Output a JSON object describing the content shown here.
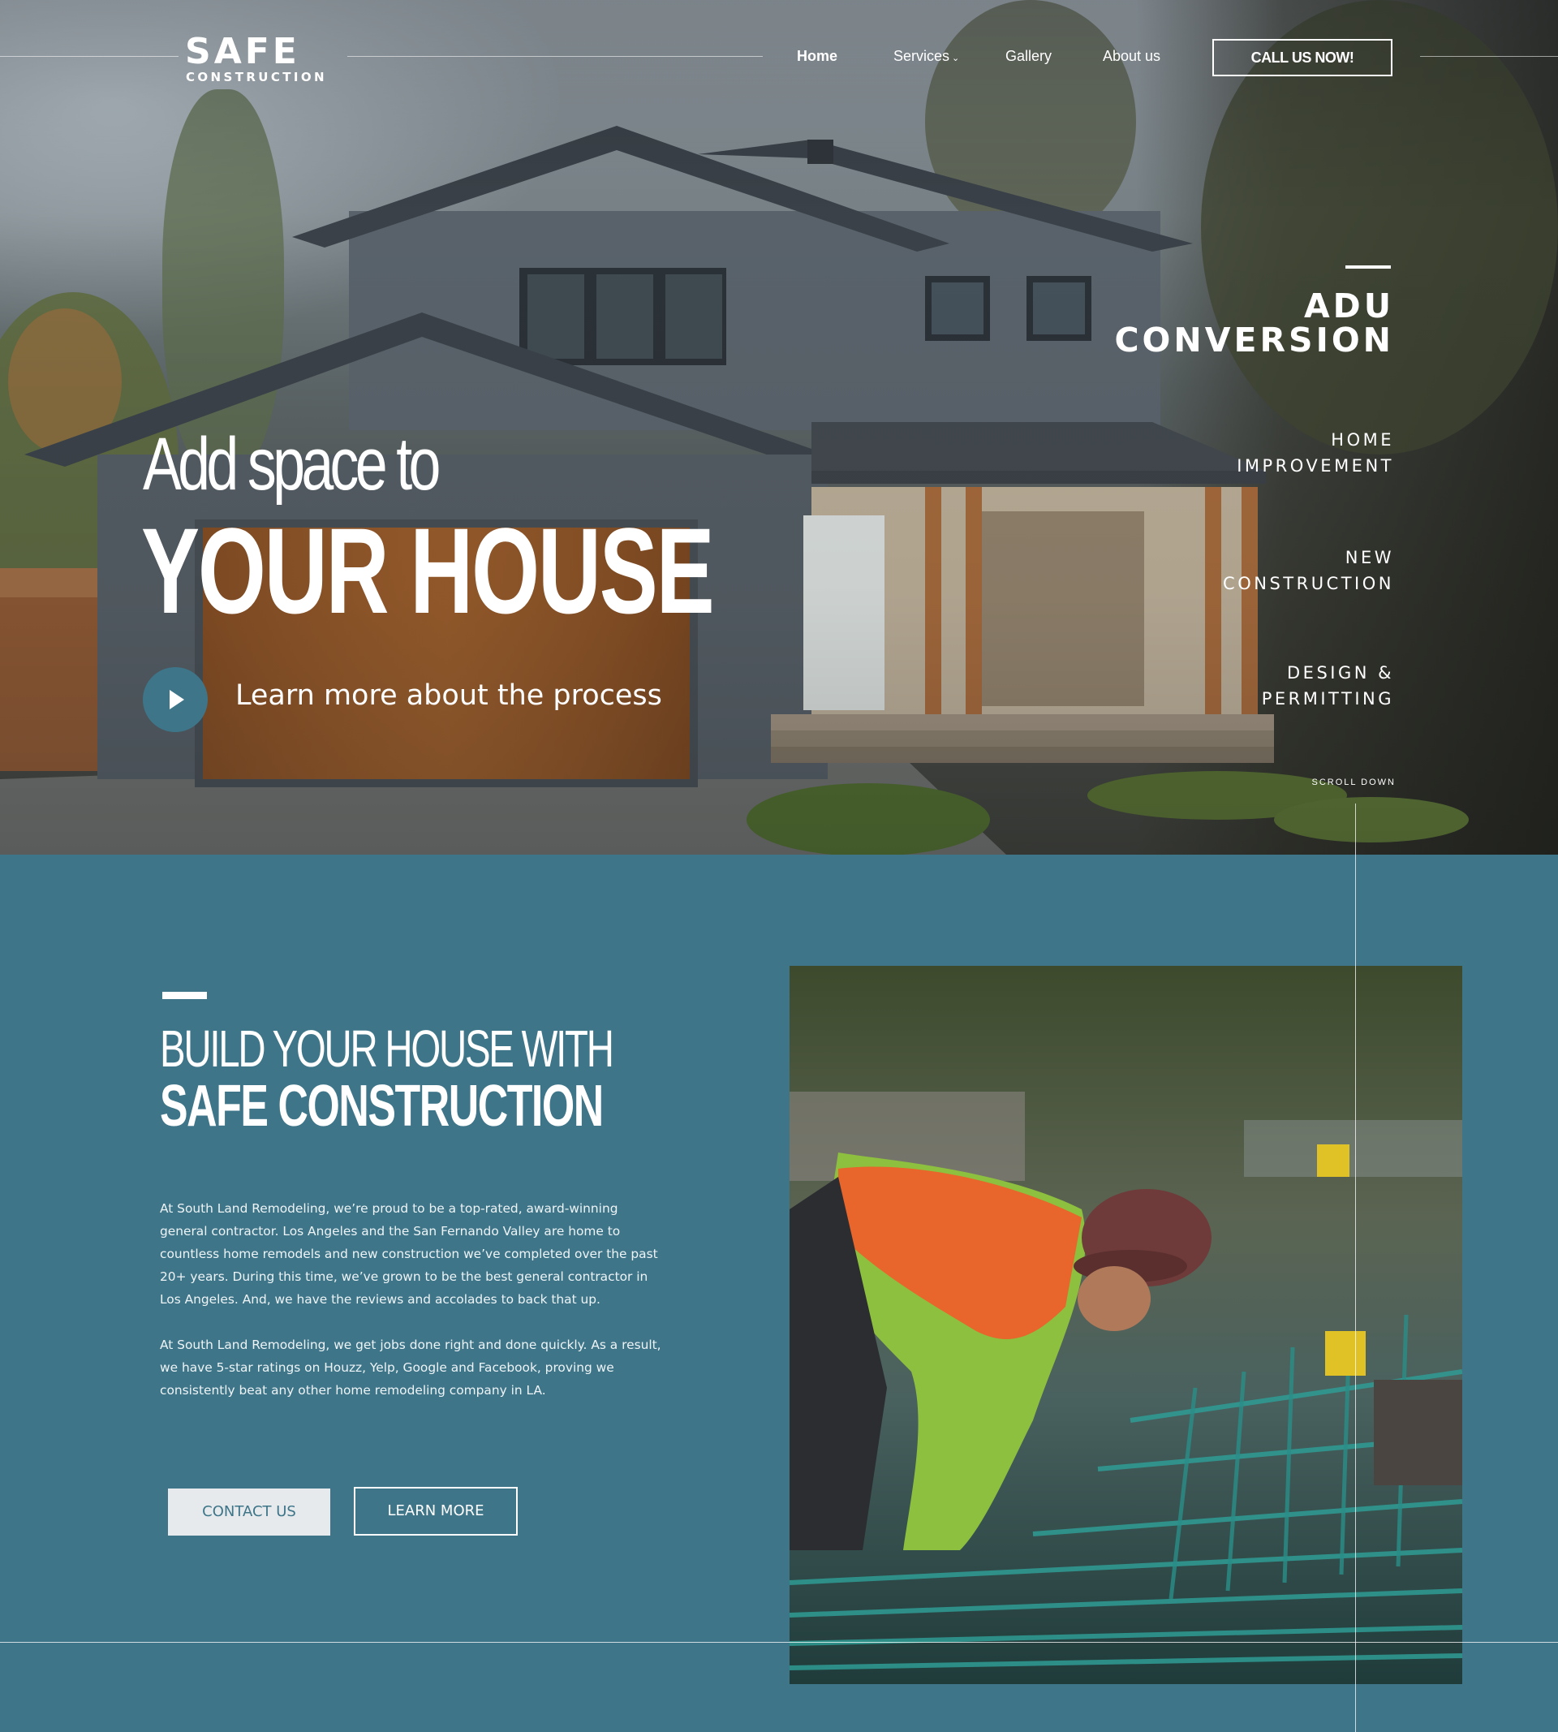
{
  "brand": {
    "logo_main": "SAFE",
    "logo_sub": "CONSTRUCTION"
  },
  "nav": {
    "items": [
      {
        "label": "Home",
        "active": true
      },
      {
        "label": "Services",
        "has_dropdown": true
      },
      {
        "label": "Gallery"
      },
      {
        "label": "About us"
      }
    ],
    "cta_label": "CALL US NOW!"
  },
  "hero": {
    "headline_line1": "Add space to",
    "headline_line2": "YOUR HOUSE",
    "video_link_label": "Learn more about the process",
    "services": [
      {
        "line1": "ADU",
        "line2": "CONVERSION",
        "featured": true
      },
      {
        "line1": "HOME",
        "line2": "IMPROVEMENT"
      },
      {
        "line1": "NEW",
        "line2": "CONSTRUCTION"
      },
      {
        "line1": "DESIGN &",
        "line2": "PERMITTING"
      }
    ],
    "scroll_label": "SCROLL DOWN"
  },
  "about": {
    "title_line1": "BUILD YOUR HOUSE WITH",
    "title_line2": "SAFE CONSTRUCTION",
    "paragraph1": "At South Land Remodeling, we’re proud to be a top-rated, award-winning general contractor. Los Angeles and the San Fernando Valley are home to countless home remodels and new construction we’ve completed over the past 20+ years. During this time, we’ve grown to be the best general contractor in Los Angeles. And, we have the reviews and accolades to back that up.",
    "paragraph2": "At South Land Remodeling, we get jobs done right and done quickly. As a result, we have 5-star ratings on Houzz, Yelp, Google and Facebook, proving we consistently beat any other home remodeling company in LA.",
    "contact_label": "CONTACT US",
    "learn_label": "LEARN MORE"
  },
  "colors": {
    "accent": "#3e7589",
    "button_light": "#e7eaec",
    "text": "#ffffff"
  },
  "icons": {
    "play": "play-icon",
    "dropdown": "chevron-down-icon"
  }
}
